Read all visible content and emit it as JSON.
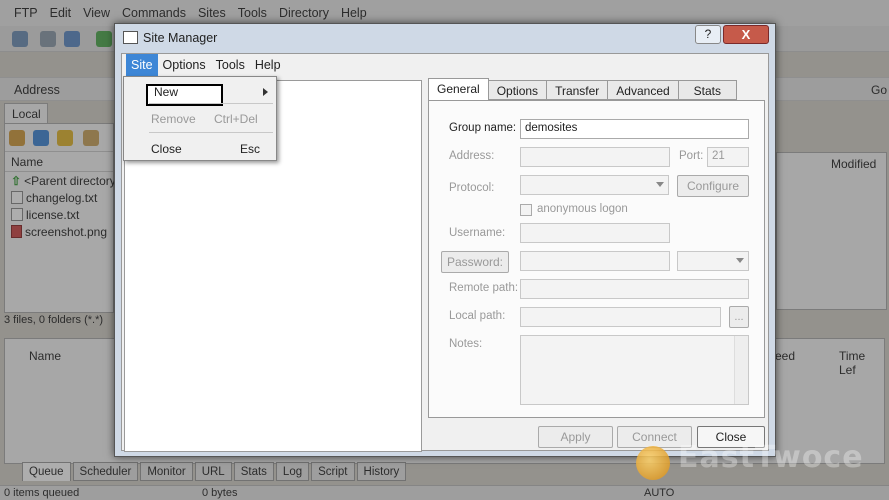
{
  "app": {
    "menu": [
      "FTP",
      "Edit",
      "View",
      "Commands",
      "Sites",
      "Tools",
      "Directory",
      "Help"
    ],
    "address_label": "Address",
    "go_label": "Go",
    "local_tab": "Local",
    "local_header": "Name",
    "local_items": [
      "<Parent directory>",
      "changelog.txt",
      "license.txt",
      "screenshot.png"
    ],
    "local_status": "3 files, 0 folders (*.*)",
    "remote_header_modified": "Modified",
    "queue_headers": {
      "name": "Name",
      "speed": "eed",
      "time_left": "Time Lef"
    },
    "queue_tabs": [
      "Queue",
      "Scheduler",
      "Monitor",
      "URL",
      "Stats",
      "Log",
      "Script",
      "History"
    ],
    "status": {
      "items": "0 items queued",
      "bytes": "0 bytes",
      "mode": "AUTO"
    }
  },
  "dialog": {
    "title": "Site Manager",
    "help": "?",
    "close": "X",
    "menu": [
      "Site",
      "Options",
      "Tools",
      "Help"
    ],
    "tabs": [
      "General",
      "Options",
      "Transfer",
      "Advanced",
      "Stats"
    ],
    "active_tab": "General",
    "fields": {
      "group_name_label": "Group name:",
      "group_name_value": "demosites",
      "address_label": "Address:",
      "port_label": "Port:",
      "port_value": "21",
      "protocol_label": "Protocol:",
      "configure": "Configure",
      "anonymous": "anonymous logon",
      "username_label": "Username:",
      "password_btn": "Password:",
      "remote_path_label": "Remote path:",
      "local_path_label": "Local path:",
      "browse": "...",
      "notes_label": "Notes:"
    },
    "buttons": {
      "apply": "Apply",
      "connect": "Connect",
      "close": "Close"
    }
  },
  "site_menu": {
    "items": [
      {
        "label": "New",
        "shortcut": ""
      },
      {
        "label": "Remove",
        "shortcut": "Ctrl+Del"
      },
      {
        "label": "Close",
        "shortcut": "Esc"
      }
    ]
  },
  "watermark": "EastTwoce"
}
